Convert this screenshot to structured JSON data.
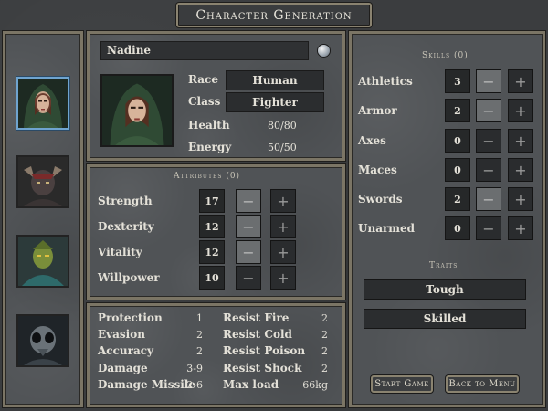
{
  "title": "Character Generation",
  "character": {
    "name": "Nadine",
    "race_label": "Race",
    "race": "Human",
    "class_label": "Class",
    "class": "Fighter",
    "health_label": "Health",
    "health": "80/80",
    "energy_label": "Energy",
    "energy": "50/50"
  },
  "attributes": {
    "title": "Attributes (0)",
    "items": [
      {
        "label": "Strength",
        "value": "17"
      },
      {
        "label": "Dexterity",
        "value": "12"
      },
      {
        "label": "Vitality",
        "value": "12"
      },
      {
        "label": "Willpower",
        "value": "10"
      }
    ],
    "minus": "−",
    "plus": "+"
  },
  "stats": {
    "left": [
      {
        "label": "Protection",
        "value": "1"
      },
      {
        "label": "Evasion",
        "value": "2"
      },
      {
        "label": "Accuracy",
        "value": "2"
      },
      {
        "label": "Damage",
        "value": "3-9"
      },
      {
        "label": "Damage Missile",
        "value": "2-6"
      }
    ],
    "right": [
      {
        "label": "Resist Fire",
        "value": "2"
      },
      {
        "label": "Resist Cold",
        "value": "2"
      },
      {
        "label": "Resist Poison",
        "value": "2"
      },
      {
        "label": "Resist Shock",
        "value": "2"
      },
      {
        "label": "Max load",
        "value": "66kg"
      }
    ]
  },
  "skills": {
    "title": "Skills (0)",
    "items": [
      {
        "label": "Athletics",
        "value": "3"
      },
      {
        "label": "Armor",
        "value": "2"
      },
      {
        "label": "Axes",
        "value": "0"
      },
      {
        "label": "Maces",
        "value": "0"
      },
      {
        "label": "Swords",
        "value": "2"
      },
      {
        "label": "Unarmed",
        "value": "0"
      }
    ]
  },
  "traits": {
    "title": "Traits",
    "items": [
      "Tough",
      "Skilled"
    ]
  },
  "buttons": {
    "start": "Start Game",
    "back": "Back to Menu"
  },
  "colors": {
    "selected_border": "#6fa4d0",
    "frame": "#7b7565"
  }
}
